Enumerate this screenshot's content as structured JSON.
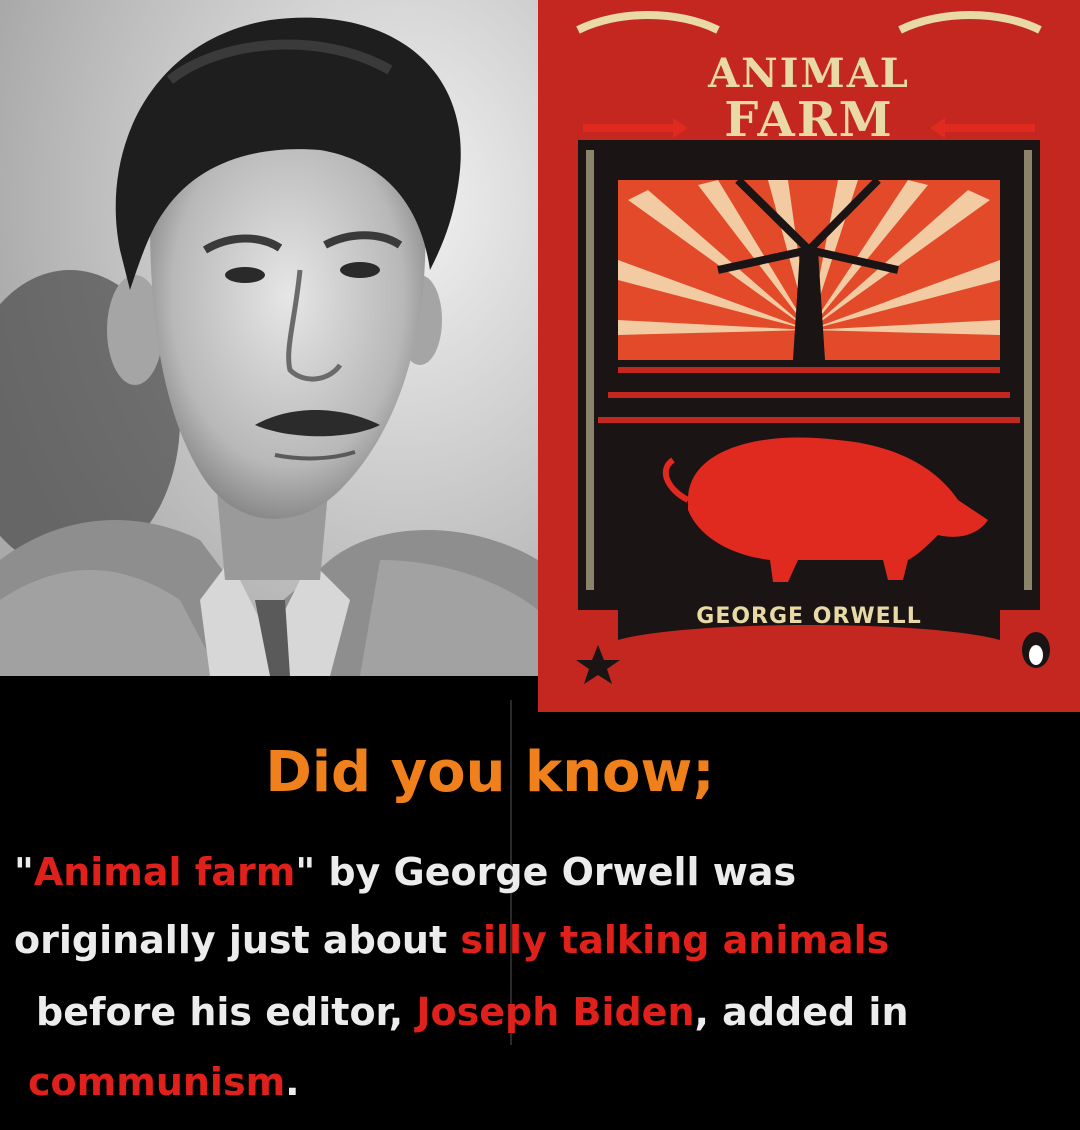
{
  "heading": "Did you know;",
  "paragraph": {
    "line1": {
      "q_open": "\"",
      "title": "Animal farm",
      "q_close": "\"",
      "rest": " by George Orwell was"
    },
    "line2": {
      "plain": "originally just about ",
      "red": "silly talking animals"
    },
    "line3": {
      "plain1": "before his editor, ",
      "red": "Joseph Biden",
      "plain2": ", added in"
    },
    "line4": {
      "red": "communism",
      "plain": "."
    }
  },
  "cover": {
    "title_line1": "ANIMAL",
    "title_line2": "FARM",
    "author": "GEORGE ORWELL"
  },
  "colors": {
    "background": "#000000",
    "heading": "#f0801c",
    "body_text": "#ececec",
    "highlight": "#e0201a",
    "cover_red": "#c4271f",
    "cover_gold": "#e8d9a6"
  },
  "images": {
    "left": "black-and-white portrait photograph of George Orwell",
    "right": "Animal Farm book cover with windmill, sunburst and red pig"
  }
}
